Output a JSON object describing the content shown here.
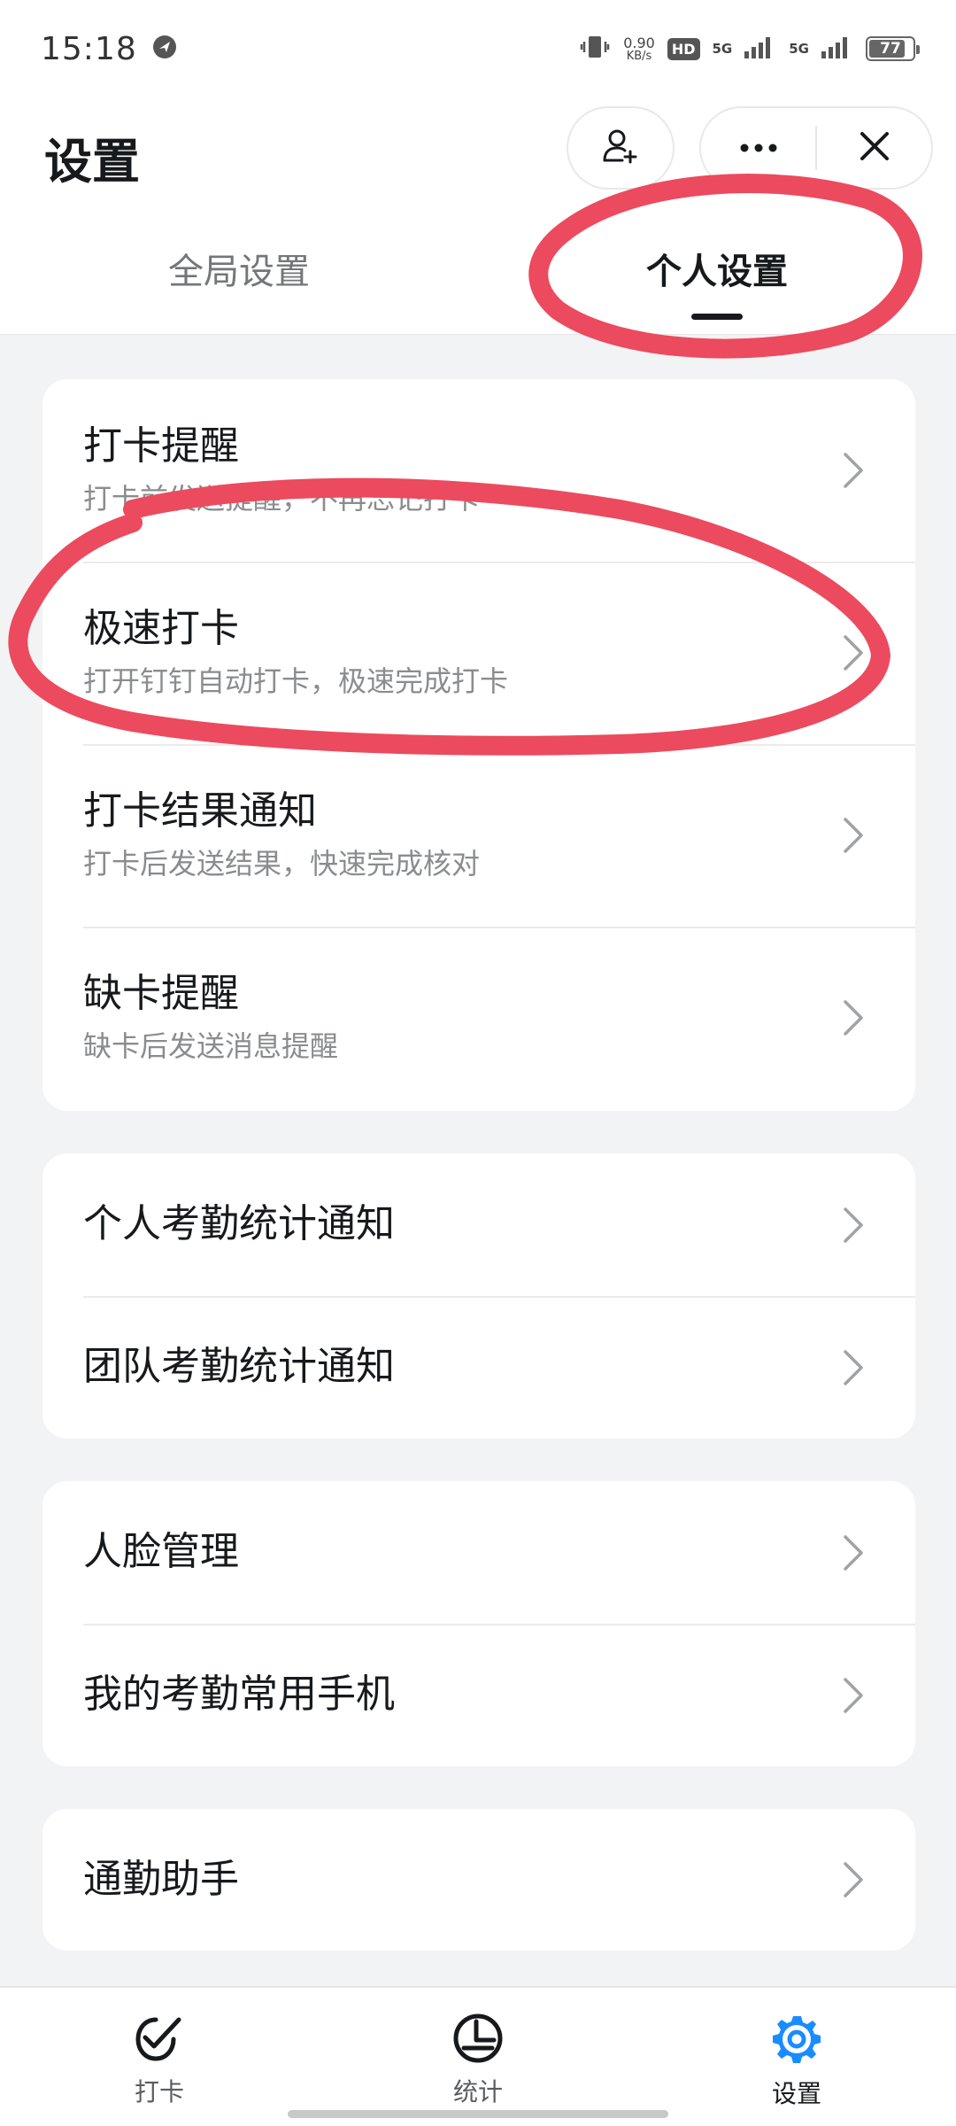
{
  "status_bar": {
    "time": "15:18",
    "net_speed_value": "0.90",
    "net_speed_unit": "KB/s",
    "hd_badge": "HD",
    "sim1_label": "5G",
    "sim2_label": "5G",
    "battery": "77"
  },
  "header": {
    "title": "设置",
    "tabs": [
      {
        "label": "全局设置",
        "active": false
      },
      {
        "label": "个人设置",
        "active": true
      }
    ]
  },
  "groups": [
    {
      "items": [
        {
          "title": "打卡提醒",
          "subtitle": "打卡前发送提醒，不再忘记打卡"
        },
        {
          "title": "极速打卡",
          "subtitle": "打开钉钉自动打卡，极速完成打卡"
        },
        {
          "title": "打卡结果通知",
          "subtitle": "打卡后发送结果，快速完成核对"
        },
        {
          "title": "缺卡提醒",
          "subtitle": "缺卡后发送消息提醒"
        }
      ]
    },
    {
      "items": [
        {
          "title": "个人考勤统计通知"
        },
        {
          "title": "团队考勤统计通知"
        }
      ]
    },
    {
      "items": [
        {
          "title": "人脸管理"
        },
        {
          "title": "我的考勤常用手机"
        }
      ]
    },
    {
      "items": [
        {
          "title": "通勤助手"
        }
      ]
    }
  ],
  "bottom_nav": [
    {
      "label": "打卡",
      "icon": "check-icon",
      "active": false
    },
    {
      "label": "统计",
      "icon": "stats-icon",
      "active": false
    },
    {
      "label": "设置",
      "icon": "gear-icon",
      "active": true
    }
  ],
  "colors": {
    "accent_blue": "#1a8cff",
    "annotation_red": "#ec4a5e",
    "background": "#f2f3f5"
  }
}
